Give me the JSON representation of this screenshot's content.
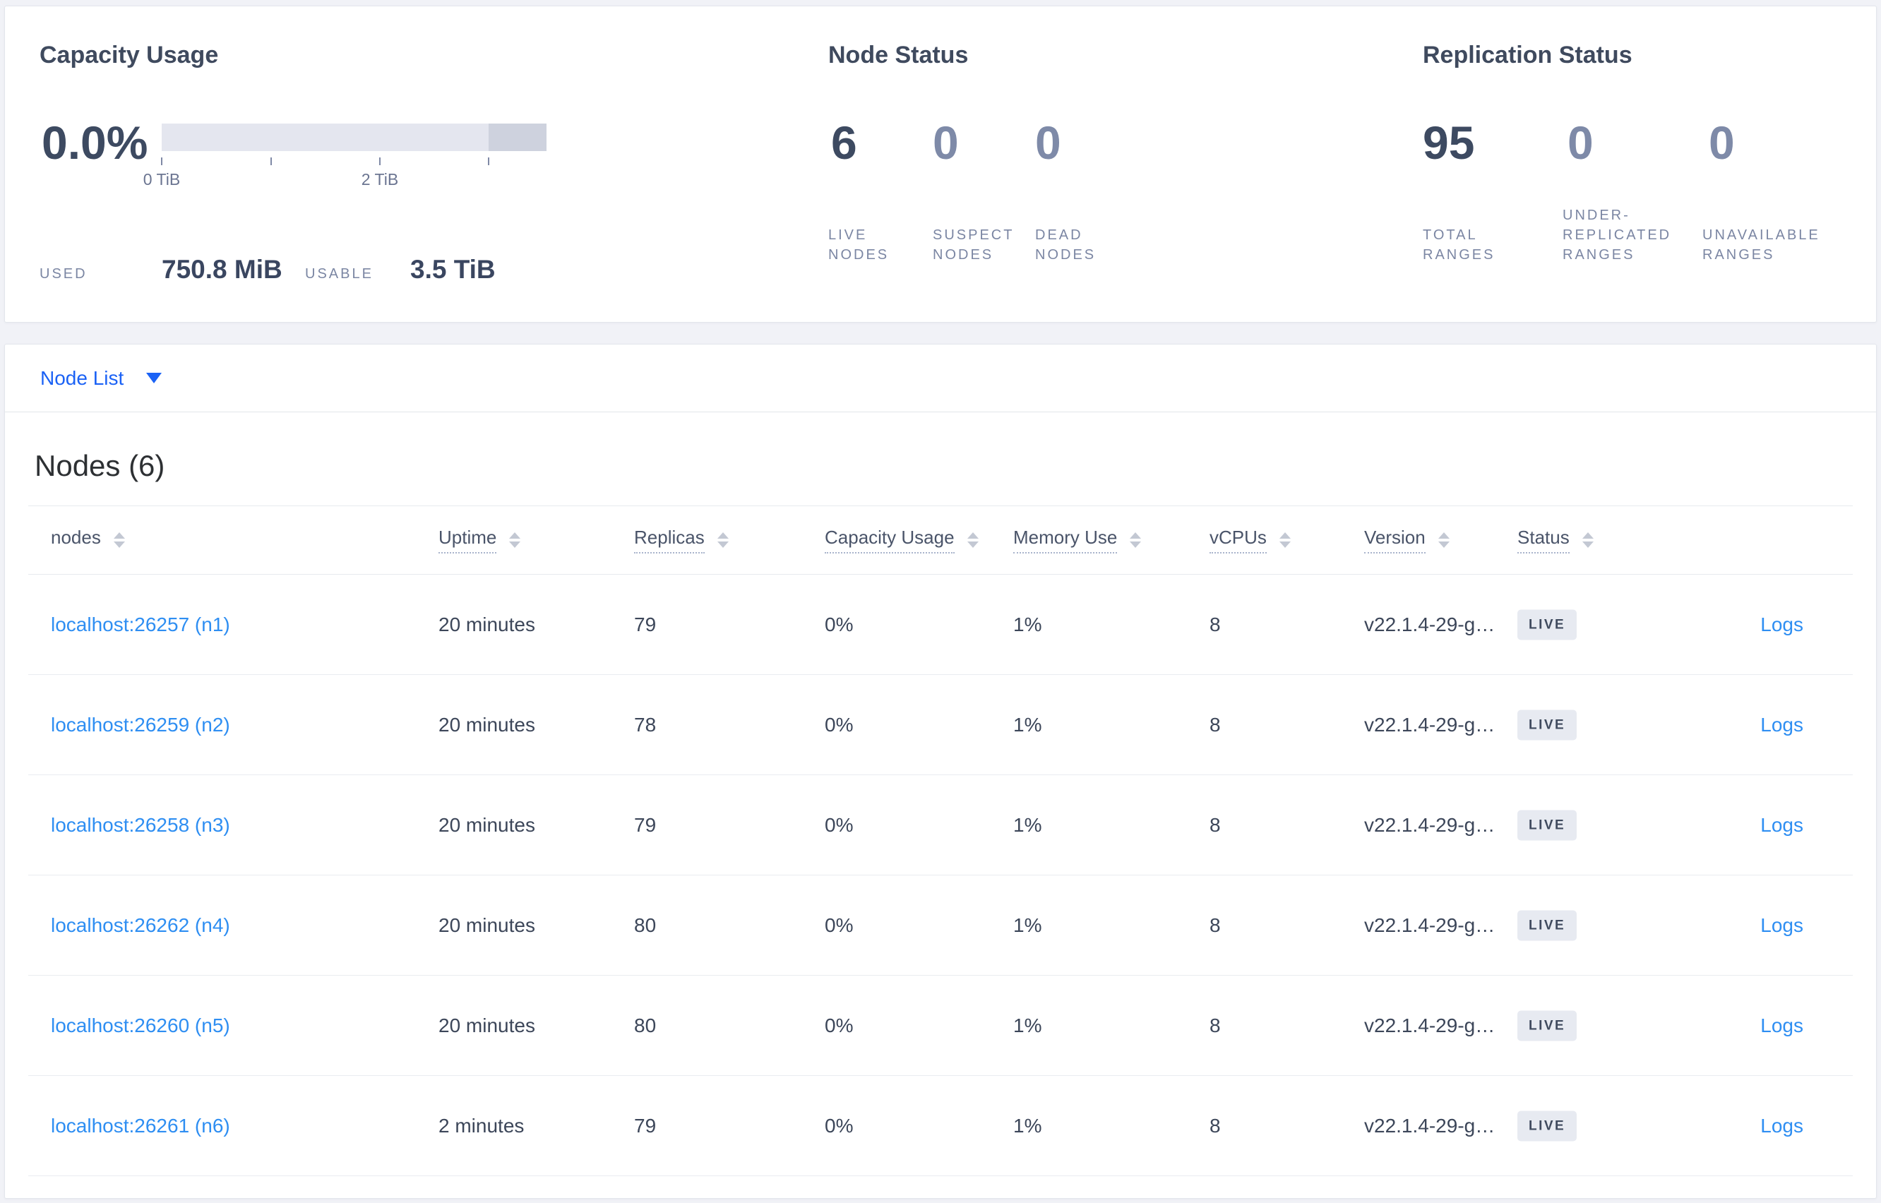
{
  "capacity_panel": {
    "title": "Capacity Usage",
    "percent": "0.0%",
    "bar": {
      "total_color": "#e4e6ef",
      "tail_color": "#ced2de"
    },
    "tick_label_0": "0 TiB",
    "tick_label_2": "2 TiB",
    "used_label": "USED",
    "used_value": "750.8 MiB",
    "usable_label": "USABLE",
    "usable_value": "3.5 TiB"
  },
  "node_status_panel": {
    "title": "Node Status",
    "stats": [
      {
        "value": "6",
        "label": "LIVE NODES"
      },
      {
        "value": "0",
        "label": "SUSPECT NODES"
      },
      {
        "value": "0",
        "label": "DEAD NODES"
      }
    ]
  },
  "replication_panel": {
    "title": "Replication Status",
    "stats": [
      {
        "value": "95",
        "label": "TOTAL RANGES"
      },
      {
        "value": "0",
        "label": "UNDER-REPLICATED RANGES"
      },
      {
        "value": "0",
        "label": "UNAVAILABLE RANGES"
      }
    ]
  },
  "node_list": {
    "label": "Node List",
    "icon": "caret-down"
  },
  "nodes": {
    "heading": "Nodes (6)",
    "logs_label": "Logs",
    "columns": [
      {
        "label": "nodes"
      },
      {
        "label": "Uptime"
      },
      {
        "label": "Replicas"
      },
      {
        "label": "Capacity Usage"
      },
      {
        "label": "Memory Use"
      },
      {
        "label": "vCPUs"
      },
      {
        "label": "Version"
      },
      {
        "label": "Status"
      }
    ],
    "rows": [
      {
        "address": "localhost:26257 (n1)",
        "uptime": "20 minutes",
        "replicas": "79",
        "capacity": "0%",
        "memory": "1%",
        "vcpus": "8",
        "version": "v22.1.4-29-g…",
        "status": "LIVE"
      },
      {
        "address": "localhost:26259 (n2)",
        "uptime": "20 minutes",
        "replicas": "78",
        "capacity": "0%",
        "memory": "1%",
        "vcpus": "8",
        "version": "v22.1.4-29-g…",
        "status": "LIVE"
      },
      {
        "address": "localhost:26258 (n3)",
        "uptime": "20 minutes",
        "replicas": "79",
        "capacity": "0%",
        "memory": "1%",
        "vcpus": "8",
        "version": "v22.1.4-29-g…",
        "status": "LIVE"
      },
      {
        "address": "localhost:26262 (n4)",
        "uptime": "20 minutes",
        "replicas": "80",
        "capacity": "0%",
        "memory": "1%",
        "vcpus": "8",
        "version": "v22.1.4-29-g…",
        "status": "LIVE"
      },
      {
        "address": "localhost:26260 (n5)",
        "uptime": "20 minutes",
        "replicas": "80",
        "capacity": "0%",
        "memory": "1%",
        "vcpus": "8",
        "version": "v22.1.4-29-g…",
        "status": "LIVE"
      },
      {
        "address": "localhost:26261 (n6)",
        "uptime": "2 minutes",
        "replicas": "79",
        "capacity": "0%",
        "memory": "1%",
        "vcpus": "8",
        "version": "v22.1.4-29-g…",
        "status": "LIVE"
      }
    ]
  },
  "colors": {
    "accent_blue": "#1b62f5",
    "link_blue": "#2e8ef2",
    "primary_text": "#3d4a61",
    "dim_stat": "#7e8aa8",
    "badge_bg": "#e7eaf1"
  }
}
